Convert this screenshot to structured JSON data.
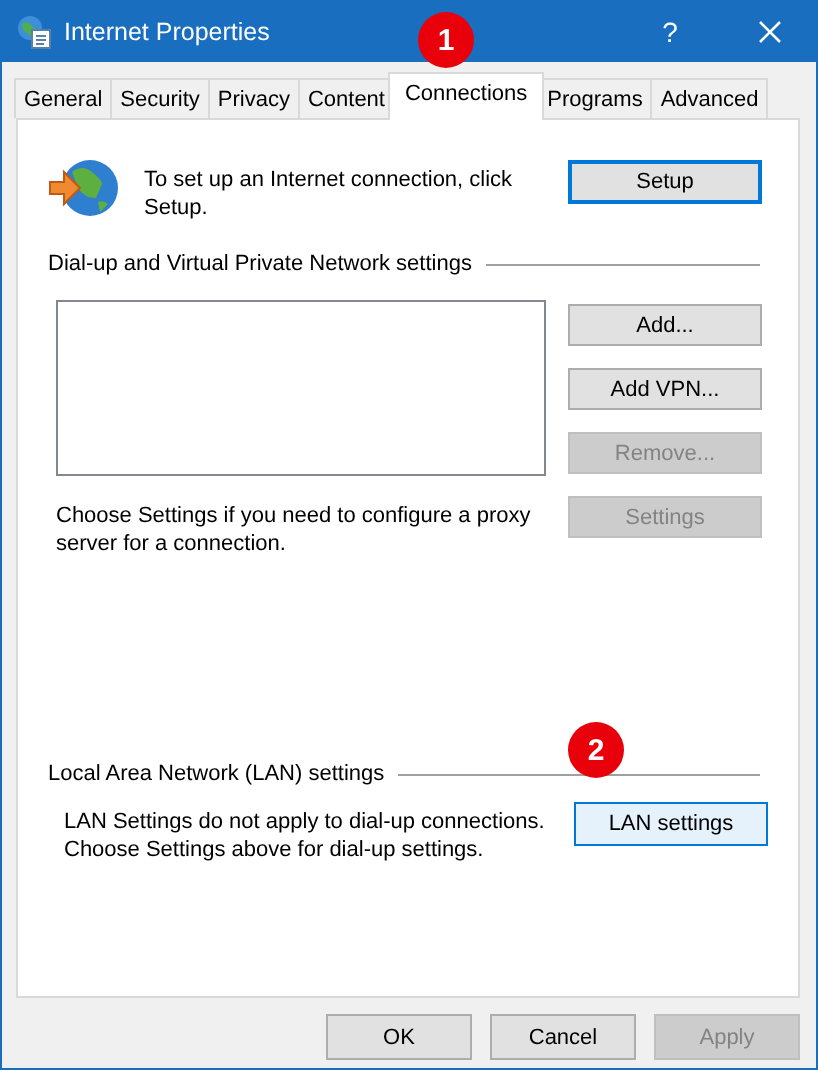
{
  "window": {
    "title": "Internet Properties",
    "help": "?"
  },
  "tabs": [
    {
      "label": "General",
      "selected": false
    },
    {
      "label": "Security",
      "selected": false
    },
    {
      "label": "Privacy",
      "selected": false
    },
    {
      "label": "Content",
      "selected": false
    },
    {
      "label": "Connections",
      "selected": true
    },
    {
      "label": "Programs",
      "selected": false
    },
    {
      "label": "Advanced",
      "selected": false
    }
  ],
  "setup": {
    "text": "To set up an Internet connection, click Setup.",
    "button": {
      "label": "Setup",
      "disabled": false,
      "focused": true
    }
  },
  "dialup": {
    "heading": "Dial-up and Virtual Private Network settings",
    "buttons": [
      {
        "label": "Add...",
        "disabled": false
      },
      {
        "label": "Add VPN...",
        "disabled": false
      },
      {
        "label": "Remove...",
        "disabled": true
      },
      {
        "label": "Settings",
        "disabled": true
      }
    ],
    "proxy_text": "Choose Settings if you need to configure a proxy server for a connection."
  },
  "lan": {
    "heading": "Local Area Network (LAN) settings",
    "text": [
      "LAN Settings do not apply to dial-up connections.",
      "Choose Settings above for dial-up settings."
    ],
    "button": {
      "label": "LAN settings",
      "disabled": false,
      "hovered": true
    }
  },
  "footer_buttons": [
    {
      "label": "OK",
      "disabled": false
    },
    {
      "label": "Cancel",
      "disabled": false
    },
    {
      "label": "Apply",
      "disabled": true
    }
  ],
  "callouts": [
    {
      "label": "1"
    },
    {
      "label": "2"
    }
  ]
}
